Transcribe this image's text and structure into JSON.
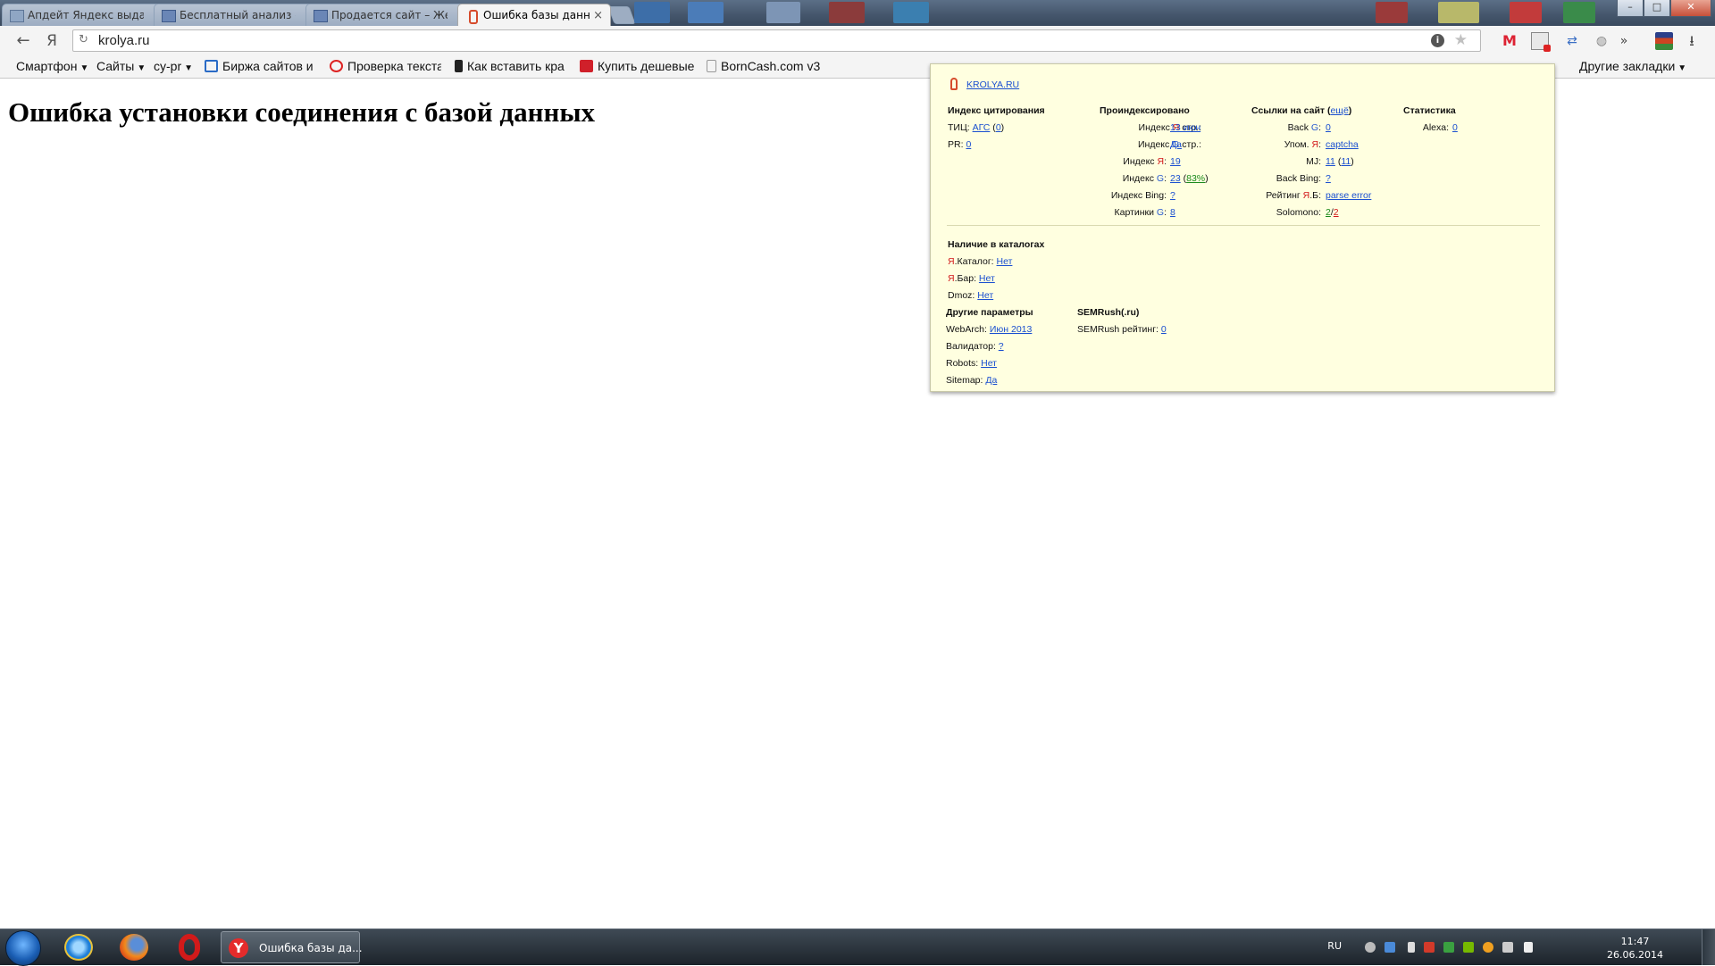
{
  "tabs": [
    {
      "label": "Апдейт Яндекс выдачи",
      "icon": "page-icon",
      "active": false
    },
    {
      "label": "Бесплатный анализ сайта",
      "icon": "page-icon",
      "active": false
    },
    {
      "label": "Продается сайт – Жен",
      "icon": "page-icon",
      "active": false
    },
    {
      "label": "Ошибка базы данных",
      "icon": "site-favicon-icon",
      "active": true
    }
  ],
  "tab_close_glyph": "×",
  "window_controls": {
    "minimize": "–",
    "maximize": "□",
    "close": "✕"
  },
  "toolbar": {
    "back_glyph": "←",
    "yandex_glyph": "Я",
    "address": "krolya.ru",
    "info_glyph": "i",
    "star_glyph": "★",
    "overflow_glyph": "»",
    "download_glyph": "⭳"
  },
  "bookmarks": [
    {
      "label": "Смартфон",
      "dropdown": true
    },
    {
      "label": "Сайты",
      "dropdown": true
    },
    {
      "label": "су-pr",
      "dropdown": true
    },
    {
      "label": "Биржа сайтов и ,",
      "icon": "exchange-icon",
      "color": "#2a6bc6"
    },
    {
      "label": "Проверка текста",
      "icon": "copyright-icon",
      "color": "#d22"
    },
    {
      "label": "Как вставить кра",
      "icon": "plug-icon",
      "color": "#222"
    },
    {
      "label": "Купить дешевые",
      "icon": "shop-icon",
      "color": "#d0202a"
    },
    {
      "label": "BornCash.com v3",
      "icon": "document-icon",
      "color": "#999"
    }
  ],
  "bookmarks_other": "Другие закладки",
  "page": {
    "heading": "Ошибка установки соединения с базой данных"
  },
  "popup": {
    "site": "KROLYA.RU",
    "col1": {
      "title": "Индекс цитирования",
      "tic_label": "ТИЦ:",
      "tic_link": "АГС",
      "tic_value": "0",
      "pr_label": "PR:",
      "pr_value": "0"
    },
    "col2": {
      "title": "Проиндексировано",
      "ya_pages_label_a": "Индекс ",
      "ya_pages_label_b": "Я",
      "ya_pages_label_c": " стр.:",
      "ya_pages_value": "13 июн",
      "g_pages_label_a": "Индекс ",
      "g_pages_label_b": "G",
      "g_pages_label_c": " стр.:",
      "g_pages_value": "Да",
      "ya_index_label_a": "Индекс ",
      "ya_index_label_b": "Я",
      "ya_index_label_c": ":",
      "ya_index_value": "19",
      "g_index_label_a": "Индекс ",
      "g_index_label_b": "G",
      "g_index_label_c": ":",
      "g_index_value": "23",
      "g_index_pct": "83%",
      "bing_label": "Индекс Bing:",
      "bing_value": "?",
      "img_label_a": "Картинки ",
      "img_label_b": "G",
      "img_label_c": ":",
      "img_value": "8"
    },
    "col3": {
      "title_a": "Ссылки на сайт (",
      "title_link": "ещё",
      "title_b": ")",
      "backg_label_a": "Back ",
      "backg_label_b": "G",
      "backg_label_c": ":",
      "backg_value": "0",
      "upom_label_a": "Упом. ",
      "upom_label_b": "Я",
      "upom_label_c": ":",
      "upom_value": "captcha",
      "mj_label": "MJ:",
      "mj_value": "11",
      "mj_value2": "11",
      "backbing_label": "Back Bing:",
      "backbing_value": "?",
      "rating_label_a": "Рейтинг ",
      "rating_label_b": "Я",
      "rating_label_c": ".Б:",
      "rating_value": "parse error",
      "solomono_label": "Solomono:",
      "solomono_a": "2",
      "solomono_b": "2"
    },
    "col4": {
      "title": "Статистика",
      "alexa_label": "Alexa:",
      "alexa_value": "0"
    },
    "catalogs": {
      "title": "Наличие в каталогах",
      "yacat_a": "Я",
      "yacat_b": ".Каталог:",
      "yacat_value": "Нет",
      "yabar_a": "Я",
      "yabar_b": ".Бар:",
      "yabar_value": "Нет",
      "dmoz_label": "Dmoz:",
      "dmoz_value": "Нет"
    },
    "other": {
      "title": "Другие параметры",
      "webarch_label": "WebArch:",
      "webarch_value": "Июн 2013",
      "validator_label": "Валидатор:",
      "validator_value": "?",
      "robots_label": "Robots:",
      "robots_value": "Нет",
      "sitemap_label": "Sitemap:",
      "sitemap_value": "Да"
    },
    "semrush": {
      "title": "SEMRush(.ru)",
      "rating_label": "SEMRush рейтинг:",
      "rating_value": "0"
    }
  },
  "taskbar": {
    "active_task": "Ошибка базы да...",
    "language": "RU",
    "time": "11:47",
    "date": "26.06.2014"
  },
  "colors": {
    "yandex_red": "#e52b2b",
    "link_blue": "#1a4fd0",
    "popup_bg": "#ffffe0"
  }
}
